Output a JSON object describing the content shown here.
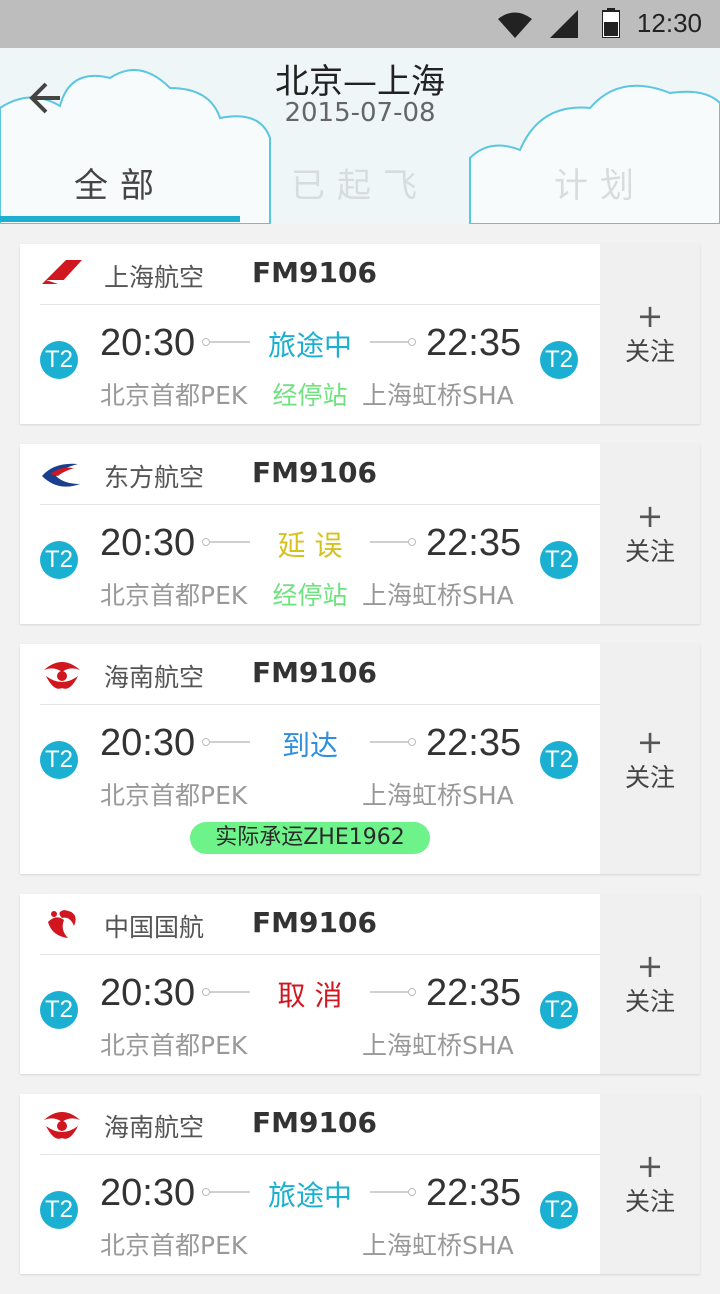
{
  "statusbar": {
    "time": "12:30"
  },
  "header": {
    "route": "北京—上海",
    "date": "2015-07-08",
    "tabs": [
      {
        "label": "全部",
        "active": true
      },
      {
        "label": "已起飞",
        "active": false
      },
      {
        "label": "计划",
        "active": false
      }
    ]
  },
  "flights": [
    {
      "airline": "上海航空",
      "flight_no": "FM9106",
      "dep_terminal": "T2",
      "dep_time": "20:30",
      "dep_airport": "北京首都PEK",
      "status": "旅途中",
      "status_color": "#1bb0d1",
      "stop": "经停站",
      "arr_terminal": "T2",
      "arr_time": "22:35",
      "arr_airport": "上海虹桥SHA",
      "carrier": "",
      "follow_plus": "+",
      "follow_label": "关注",
      "logo": "shanghai-airlines-logo"
    },
    {
      "airline": "东方航空",
      "flight_no": "FM9106",
      "dep_terminal": "T2",
      "dep_time": "20:30",
      "dep_airport": "北京首都PEK",
      "status": "延 误",
      "status_color": "#d6c21c",
      "stop": "经停站",
      "arr_terminal": "T2",
      "arr_time": "22:35",
      "arr_airport": "上海虹桥SHA",
      "carrier": "",
      "follow_plus": "+",
      "follow_label": "关注",
      "logo": "china-eastern-logo"
    },
    {
      "airline": "海南航空",
      "flight_no": "FM9106",
      "dep_terminal": "T2",
      "dep_time": "20:30",
      "dep_airport": "北京首都PEK",
      "status": "到达",
      "status_color": "#2f8fdc",
      "stop": "",
      "arr_terminal": "T2",
      "arr_time": "22:35",
      "arr_airport": "上海虹桥SHA",
      "carrier": "实际承运ZHE1962",
      "follow_plus": "+",
      "follow_label": "关注",
      "logo": "hainan-airlines-logo"
    },
    {
      "airline": "中国国航",
      "flight_no": "FM9106",
      "dep_terminal": "T2",
      "dep_time": "20:30",
      "dep_airport": "北京首都PEK",
      "status": "取 消",
      "status_color": "#d0161f",
      "stop": "",
      "arr_terminal": "T2",
      "arr_time": "22:35",
      "arr_airport": "上海虹桥SHA",
      "carrier": "",
      "follow_plus": "+",
      "follow_label": "关注",
      "logo": "air-china-logo"
    },
    {
      "airline": "海南航空",
      "flight_no": "FM9106",
      "dep_terminal": "T2",
      "dep_time": "20:30",
      "dep_airport": "北京首都PEK",
      "status": "旅途中",
      "status_color": "#1bb0d1",
      "stop": "",
      "arr_terminal": "T2",
      "arr_time": "22:35",
      "arr_airport": "上海虹桥SHA",
      "carrier": "",
      "follow_plus": "+",
      "follow_label": "关注",
      "logo": "hainan-airlines-logo"
    }
  ]
}
